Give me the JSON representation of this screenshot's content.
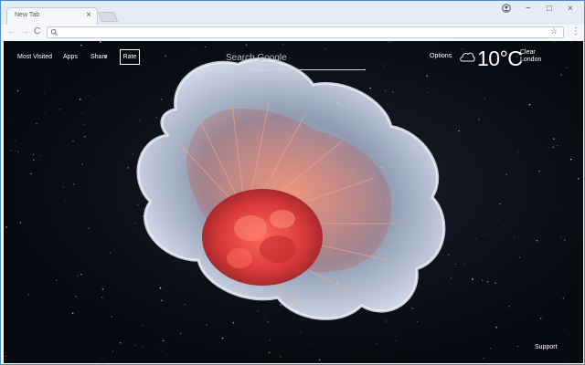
{
  "browser": {
    "tab_title": "New Tab",
    "tab_close": "×",
    "window_controls": {
      "minimize": "−",
      "maximize": "□",
      "close": "×"
    },
    "nav": {
      "back": "←",
      "forward": "→",
      "reload": "C"
    },
    "address_value": "",
    "bookmark_star": "☆",
    "menu": "⋮"
  },
  "page": {
    "links": [
      "Most Visited",
      "Apps",
      "Share"
    ],
    "rate_label": "Rate",
    "search_placeholder": "Search Google",
    "options_label": "Options",
    "weather": {
      "temperature": "10°C",
      "condition": "Clear",
      "location": "London",
      "icon": "cloud-icon"
    },
    "support_label": "Support"
  },
  "colors": {
    "background": "#070910",
    "jellyfish_bell": "#c9d6ec",
    "jellyfish_core": "#e0453f"
  }
}
